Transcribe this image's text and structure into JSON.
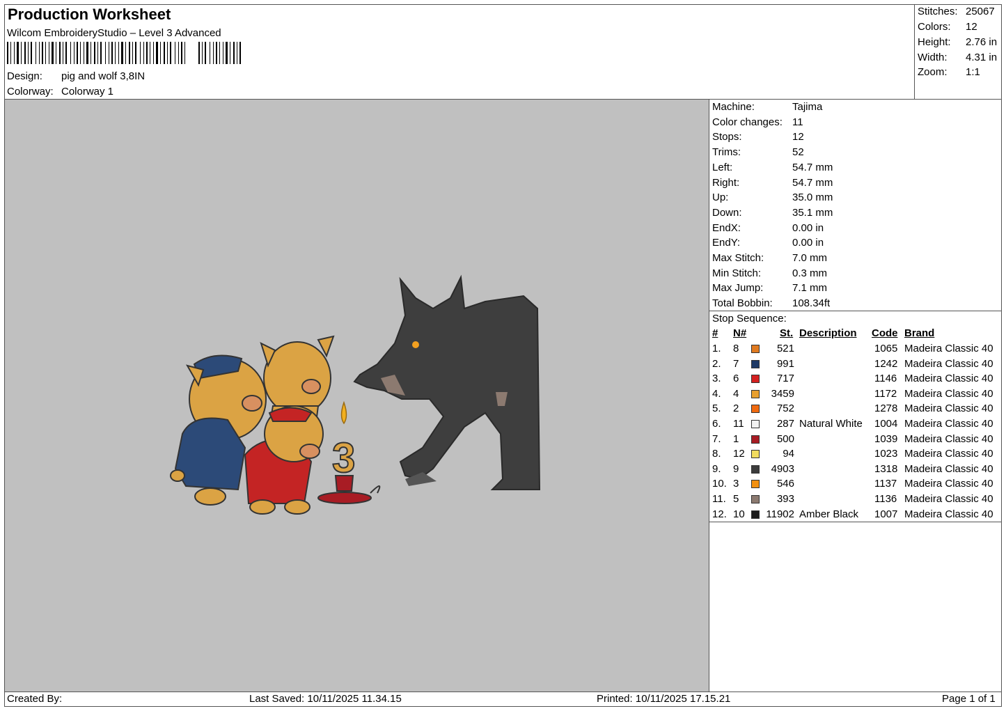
{
  "header": {
    "title": "Production Worksheet",
    "software": "Wilcom EmbroideryStudio – Level 3 Advanced",
    "design_label": "Design:",
    "design_value": "pig and wolf 3,8IN",
    "colorway_label": "Colorway:",
    "colorway_value": "Colorway 1"
  },
  "summary": {
    "stitches_label": "Stitches:",
    "stitches_value": "25067",
    "colors_label": "Colors:",
    "colors_value": "12",
    "height_label": "Height:",
    "height_value": "2.76 in",
    "width_label": "Width:",
    "width_value": "4.31 in",
    "zoom_label": "Zoom:",
    "zoom_value": "1:1"
  },
  "machine_info": [
    {
      "label": "Machine:",
      "value": "Tajima"
    },
    {
      "label": "Color changes:",
      "value": "11"
    },
    {
      "label": "Stops:",
      "value": "12"
    },
    {
      "label": "Trims:",
      "value": "52"
    },
    {
      "label": "Left:",
      "value": "54.7 mm"
    },
    {
      "label": "Right:",
      "value": "54.7 mm"
    },
    {
      "label": "Up:",
      "value": "35.0 mm"
    },
    {
      "label": "Down:",
      "value": "35.1 mm"
    },
    {
      "label": "EndX:",
      "value": "0.00 in"
    },
    {
      "label": "EndY:",
      "value": "0.00 in"
    },
    {
      "label": "Max Stitch:",
      "value": "7.0 mm"
    },
    {
      "label": "Min Stitch:",
      "value": "0.3 mm"
    },
    {
      "label": "Max Jump:",
      "value": "7.1 mm"
    },
    {
      "label": "Total Bobbin:",
      "value": "108.34ft"
    }
  ],
  "stop_sequence": {
    "title": "Stop Sequence:",
    "columns": {
      "index": "#",
      "needle": "N#",
      "stitches": "St.",
      "description": "Description",
      "code": "Code",
      "brand": "Brand"
    },
    "rows": [
      {
        "index": "1.",
        "needle": "8",
        "color": "#e07a20",
        "stitches": "521",
        "description": "",
        "code": "1065",
        "brand": "Madeira Classic 40"
      },
      {
        "index": "2.",
        "needle": "7",
        "color": "#1e3a66",
        "stitches": "991",
        "description": "",
        "code": "1242",
        "brand": "Madeira Classic 40"
      },
      {
        "index": "3.",
        "needle": "6",
        "color": "#d42020",
        "stitches": "717",
        "description": "",
        "code": "1146",
        "brand": "Madeira Classic 40"
      },
      {
        "index": "4.",
        "needle": "4",
        "color": "#e8a030",
        "stitches": "3459",
        "description": "",
        "code": "1172",
        "brand": "Madeira Classic 40"
      },
      {
        "index": "5.",
        "needle": "2",
        "color": "#f06a10",
        "stitches": "752",
        "description": "",
        "code": "1278",
        "brand": "Madeira Classic 40"
      },
      {
        "index": "6.",
        "needle": "11",
        "color": "#f2f2f2",
        "stitches": "287",
        "description": "Natural White",
        "code": "1004",
        "brand": "Madeira Classic 40"
      },
      {
        "index": "7.",
        "needle": "1",
        "color": "#a81c24",
        "stitches": "500",
        "description": "",
        "code": "1039",
        "brand": "Madeira Classic 40"
      },
      {
        "index": "8.",
        "needle": "12",
        "color": "#f2dc60",
        "stitches": "94",
        "description": "",
        "code": "1023",
        "brand": "Madeira Classic 40"
      },
      {
        "index": "9.",
        "needle": "9",
        "color": "#3c3c3c",
        "stitches": "4903",
        "description": "",
        "code": "1318",
        "brand": "Madeira Classic 40"
      },
      {
        "index": "10.",
        "needle": "3",
        "color": "#f29010",
        "stitches": "546",
        "description": "",
        "code": "1137",
        "brand": "Madeira Classic 40"
      },
      {
        "index": "11.",
        "needle": "5",
        "color": "#8c7a70",
        "stitches": "393",
        "description": "",
        "code": "1136",
        "brand": "Madeira Classic 40"
      },
      {
        "index": "12.",
        "needle": "10",
        "color": "#1c1c1c",
        "stitches": "11902",
        "description": "Amber Black",
        "code": "1007",
        "brand": "Madeira Classic 40"
      }
    ]
  },
  "footer": {
    "created_by": "Created By:",
    "last_saved": "Last Saved: 10/11/2025 11.34.15",
    "printed": "Printed: 10/11/2025 17.15.21",
    "page": "Page 1 of 1"
  },
  "colors": {
    "canvas": "#c0c0c0",
    "wolf": "#3e3e3e",
    "pig": "#dba344",
    "blue_shirt": "#2c4a78",
    "red_shirt": "#c42424",
    "candle_flame": "#f2b020"
  }
}
